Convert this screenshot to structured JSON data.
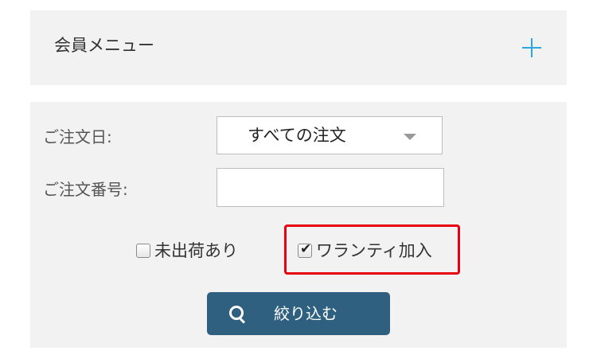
{
  "member_menu": {
    "title": "会員メニュー",
    "expand_icon": "plus-icon",
    "accent_color": "#2aa8e0"
  },
  "filters": {
    "order_date_label": "ご注文日:",
    "order_date_value": "すべての注文",
    "order_number_label": "ご注文番号:",
    "order_number_value": "",
    "unshipped_label": "未出荷あり",
    "unshipped_checked": false,
    "warranty_label": "ワランティ加入",
    "warranty_checked": true,
    "highlight_color": "#e60012"
  },
  "search_button": {
    "label": "絞り込む",
    "icon": "search-icon",
    "color": "#2f6080"
  }
}
